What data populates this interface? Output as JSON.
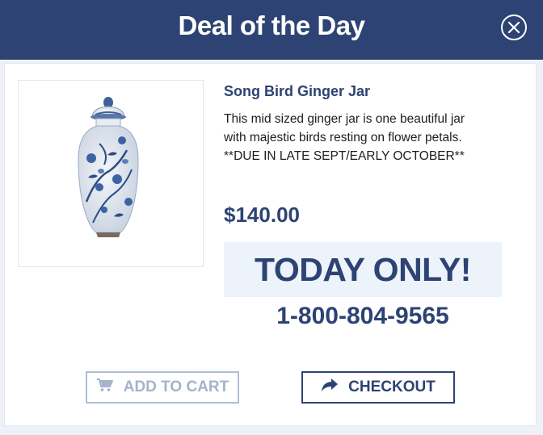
{
  "modal": {
    "title": "Deal of the Day",
    "close_icon": "close-circle-icon",
    "colors": {
      "header": "#2d4373",
      "accent": "#2d4373",
      "banner": "#edf3fb"
    }
  },
  "product": {
    "name": "Song Bird Ginger Jar",
    "description_lines": [
      "This mid sized ginger jar is one beautiful jar",
      "with majestic birds resting on flower petals.",
      "**DUE IN LATE SEPT/EARLY OCTOBER**"
    ],
    "price": "$140.00",
    "promo": "TODAY ONLY!",
    "phone": "1-800-804-9565",
    "image_icon": "ginger-jar-image"
  },
  "actions": {
    "add_to_cart": {
      "label": "ADD TO CART",
      "icon": "cart-icon"
    },
    "checkout": {
      "label": "CHECKOUT",
      "icon": "share-arrow-icon"
    }
  }
}
